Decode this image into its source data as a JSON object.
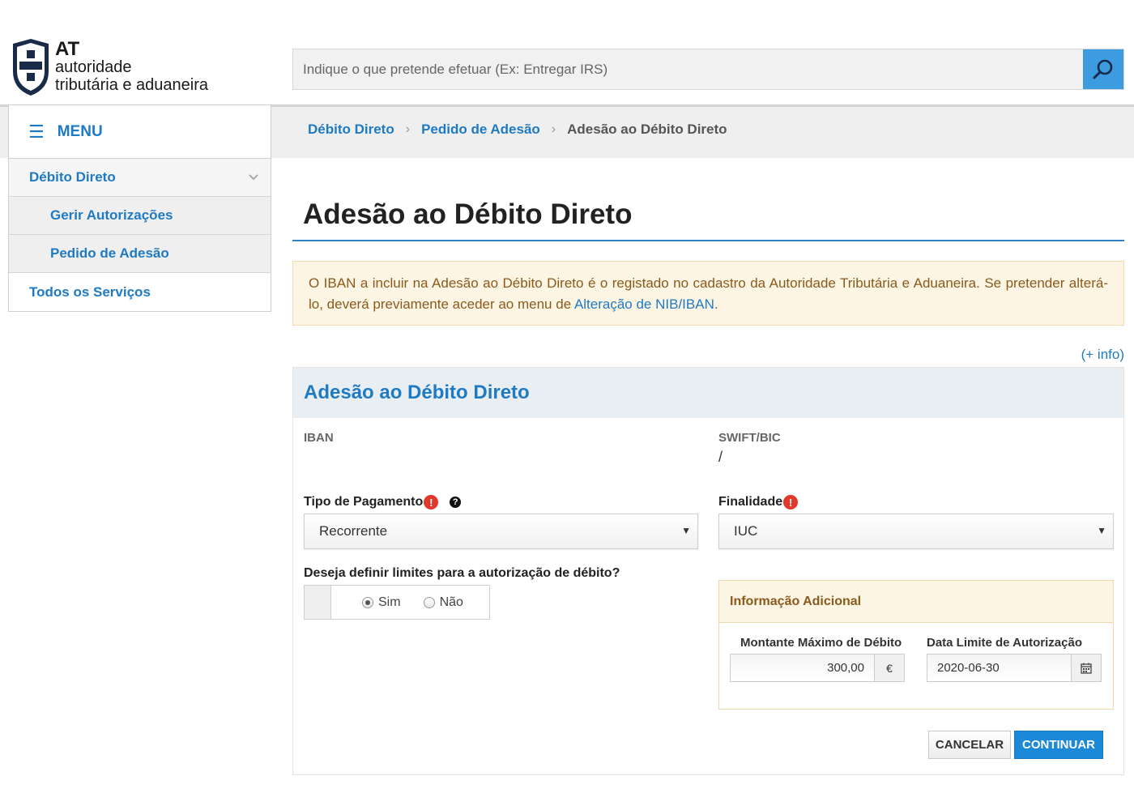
{
  "header": {
    "logo_line1": "AT",
    "logo_line2": "autoridade",
    "logo_line3": "tributária e aduaneira",
    "search_placeholder": "Indique o que pretende efetuar (Ex: Entregar IRS)",
    "accent_color": "#3d9be0"
  },
  "breadcrumb": {
    "items": [
      "Débito Direto",
      "Pedido de Adesão",
      "Adesão ao Débito Direto"
    ],
    "separator": "›"
  },
  "sidebar": {
    "menu_label": "MENU",
    "items": [
      {
        "label": "Débito Direto",
        "level": 1
      },
      {
        "label": "Gerir Autorizações",
        "level": 2
      },
      {
        "label": "Pedido de Adesão",
        "level": 2
      },
      {
        "label": "Todos os Serviços",
        "level": 1
      }
    ]
  },
  "main": {
    "title": "Adesão ao Débito Direto",
    "alert_text": "O IBAN a incluir na Adesão ao Débito Direto é o registado no cadastro da Autoridade Tributária e Aduaneira. Se pretender alterá-lo, deverá previamente aceder ao menu de ",
    "alert_link": "Alteração de NIB/IBAN",
    "alert_end": ".",
    "more_info": "(+ info)"
  },
  "form": {
    "panel_title": "Adesão ao Débito Direto",
    "iban_label": "IBAN",
    "iban_value": "",
    "swift_label": "SWIFT/BIC",
    "swift_value": "/",
    "tipo_label": "Tipo de Pagamento",
    "tipo_value": "Recorrente",
    "finalidade_label": "Finalidade",
    "finalidade_value": "IUC",
    "limits_question": "Deseja definir limites para a autorização de débito?",
    "radio_yes": "Sim",
    "radio_no": "Não",
    "radio_selected": "Sim",
    "info_title": "Informação Adicional",
    "montante_label": "Montante Máximo de Débito",
    "montante_value": "300,00",
    "currency": "€",
    "data_label": "Data Limite de Autorização",
    "data_value": "2020-06-30",
    "cancel_label": "CANCELAR",
    "continue_label": "CONTINUAR"
  }
}
